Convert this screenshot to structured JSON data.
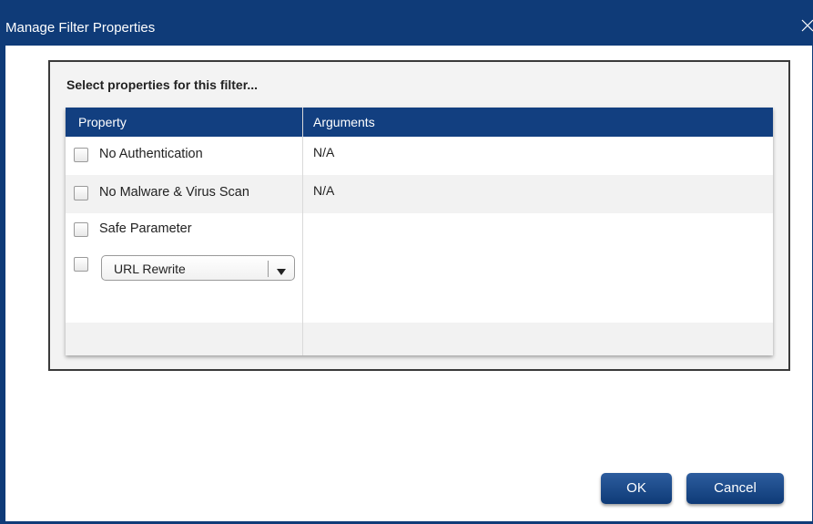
{
  "dialog": {
    "title": "Manage Filter Properties"
  },
  "panel": {
    "label": "Select properties for this filter..."
  },
  "grid": {
    "columns": [
      "Property",
      "Arguments"
    ],
    "rows": [
      {
        "property": "No Authentication",
        "argument": "N/A",
        "checked": false
      },
      {
        "property": "No Malware & Virus Scan",
        "argument": "N/A",
        "checked": false
      },
      {
        "property": "Safe Parameter",
        "argument": "",
        "checked": false
      }
    ],
    "select_row": {
      "selected": "URL Rewrite",
      "checked": false
    }
  },
  "buttons": {
    "ok": "OK",
    "cancel": "Cancel"
  },
  "colors": {
    "title_bar": "#0f3b78",
    "grid_header": "#123f80",
    "button": "#0e3a77"
  },
  "icons": {
    "close": "close-icon",
    "dropdown": "chevron-down-icon"
  }
}
